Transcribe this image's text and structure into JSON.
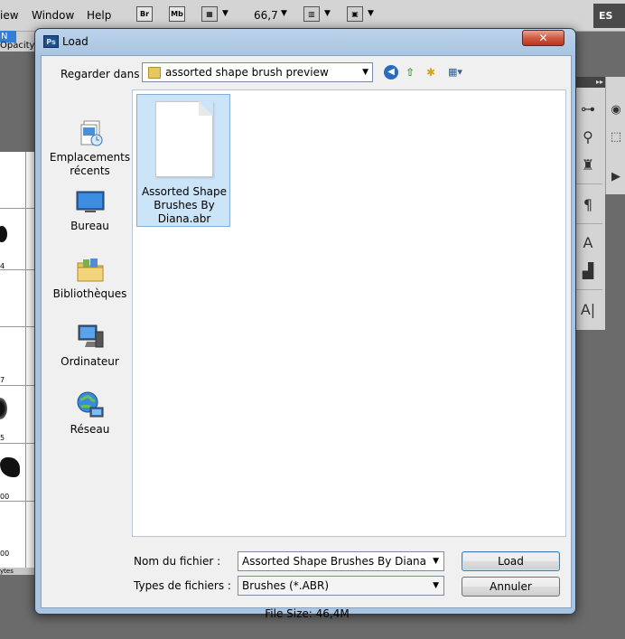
{
  "ps": {
    "menus": [
      "iew",
      "Window",
      "Help"
    ],
    "toolbar": {
      "br": "Br",
      "mb": "Mb",
      "zoom": "66,7"
    },
    "workspace": "ES",
    "mode": "N",
    "opacity_label": "Opacity",
    "brush_sizes": [
      "4",
      "7",
      "5",
      "00",
      "00"
    ],
    "status_text": "ytes",
    "panel_header": "▸▸"
  },
  "dialog": {
    "title": "Load",
    "app_badge": "Ps",
    "close_glyph": "✕",
    "look_in_label": "Regarder dans :",
    "look_in_value": "assorted shape brush preview",
    "places": [
      {
        "label": "Emplacements récents",
        "icon": "recent-places-icon"
      },
      {
        "label": "Bureau",
        "icon": "desktop-icon"
      },
      {
        "label": "Bibliothèques",
        "icon": "libraries-icon"
      },
      {
        "label": "Ordinateur",
        "icon": "computer-icon"
      },
      {
        "label": "Réseau",
        "icon": "network-icon"
      }
    ],
    "file": {
      "name": "Assorted Shape Brushes By Diana.abr"
    },
    "filename_label": "Nom du fichier :",
    "filename_value": "Assorted Shape Brushes By Diana",
    "filetype_label": "Types de fichiers :",
    "filetype_value": "Brushes (*.ABR)",
    "load_label": "Load",
    "cancel_label": "Annuler",
    "file_size": "File Size: 46,4M"
  }
}
